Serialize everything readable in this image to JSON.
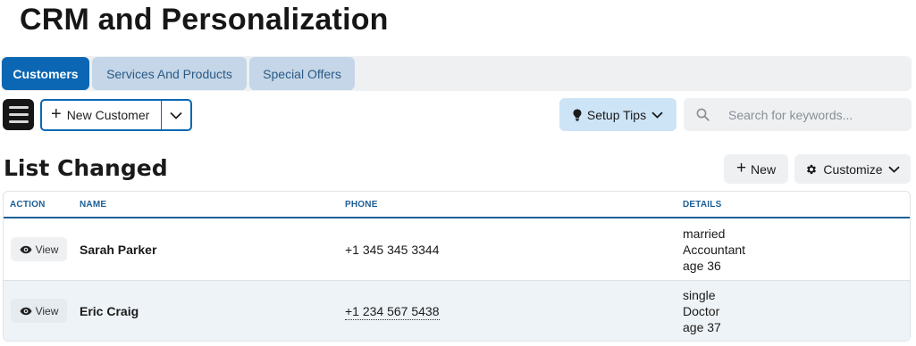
{
  "page": {
    "title": "CRM and Personalization"
  },
  "tabs": [
    {
      "label": "Customers",
      "active": true
    },
    {
      "label": "Services And Products",
      "active": false
    },
    {
      "label": "Special Offers",
      "active": false
    }
  ],
  "toolbar": {
    "menu_icon": "hamburger-icon",
    "new_customer_label": "New Customer",
    "setup_tips_label": "Setup Tips",
    "search_placeholder": "Search for keywords..."
  },
  "list": {
    "title": "List Changed",
    "new_label": "New",
    "customize_label": "Customize",
    "columns": {
      "action": "ACTION",
      "name": "NAME",
      "phone": "PHONE",
      "details": "DETAILS"
    },
    "rows": [
      {
        "view_label": "View",
        "name": "Sarah Parker",
        "phone": "+1 345 345 3344",
        "details": [
          "married",
          "Accountant",
          "age 36"
        ]
      },
      {
        "view_label": "View",
        "name": "Eric Craig",
        "phone": "+1 234 567 5438",
        "details": [
          "single",
          "Doctor",
          "age 37"
        ]
      }
    ]
  },
  "colors": {
    "accent": "#0b67b3",
    "tab_inactive": "#c4d6e7",
    "tips_bg": "#cde4f7",
    "header_text": "#1d5f96"
  }
}
